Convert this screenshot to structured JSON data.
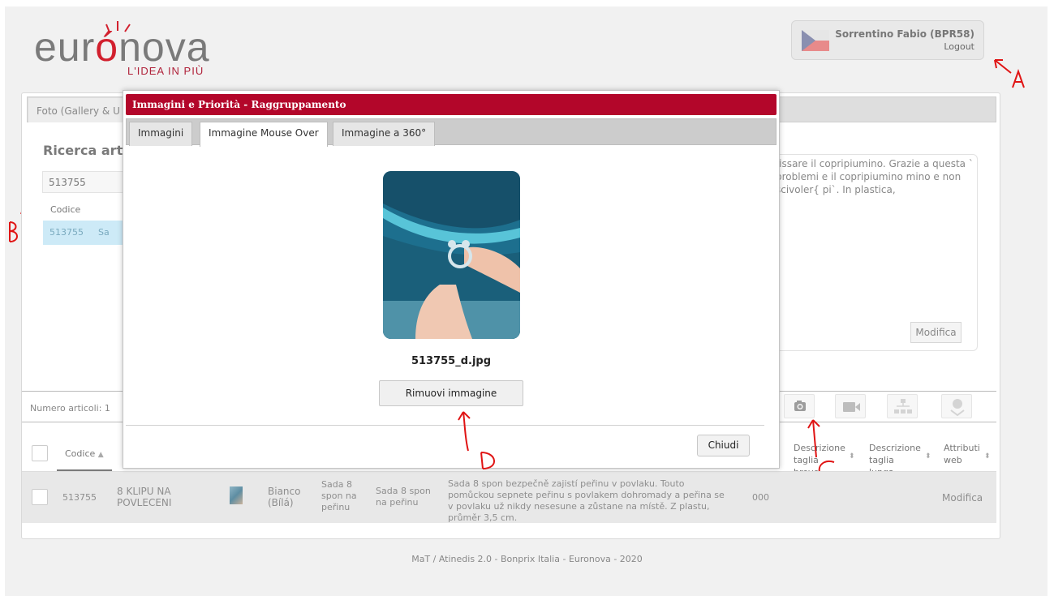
{
  "brand": {
    "logo_prefix": "eur",
    "logo_accent": "ó",
    "logo_suffix": "nova",
    "tagline": "L'IDEA IN PIÙ"
  },
  "user": {
    "name": "Sorrentino Fabio (BPR58)",
    "logout_label": "Logout",
    "flag_icon": "czech-flag-icon"
  },
  "annotations": {
    "a": "A",
    "b": "B",
    "c": "C",
    "d": "D"
  },
  "background": {
    "tab_label": "Foto (Gallery & U",
    "search_title": "Ricerca art",
    "search_value": "513755",
    "result_header": "Codice",
    "result_code": "513755",
    "result_fragment": "Sa",
    "description_text": "fissare il copripiumino. Grazie a questa ` problemi e il copripiumino mino e non scivoler{ pi`. In plastica,",
    "modifica_label": "Modifica",
    "numero_articoli": "Numero articoli: 1",
    "icons": [
      "camera-icon",
      "video-icon",
      "hierarchy-icon",
      "download-icon"
    ]
  },
  "table": {
    "headers": {
      "codice": "Codice",
      "descrizione_breve": "Descrizione taglia breve",
      "descrizione_lunga": "Descrizione taglia lunga",
      "attributi_web": "Attributi web"
    },
    "row": {
      "codice": "513755",
      "nome": "8 KLIPU NA POVLECENI",
      "colore": "Bianco (Bílá)",
      "breve": "Sada 8 spon na peřinu",
      "media": "Sada 8 spon na peřinu",
      "lunga": "Sada 8 spon bezpečně zajistí peřinu v povlaku. Touto pomůckou sepnete peřinu s povlakem dohromady a peřina se v povlaku už nikdy nesesune a zůstane na místě. Z plastu, průměr 3,5 cm.",
      "taglia": "000",
      "attributi": "Modifica"
    }
  },
  "modal": {
    "title": "Immagini e Priorità - Raggruppamento",
    "tabs": [
      "Immagini",
      "Immagine Mouse Over",
      "Immagine a 360°"
    ],
    "active_tab": "Immagine Mouse Over",
    "filename": "513755_d.jpg",
    "remove_label": "Rimuovi immagine",
    "close_label": "Chiudi"
  },
  "footer": "MaT / Atinedis 2.0 - Bonprix Italia - Euronova - 2020",
  "colors": {
    "modal_header": "#b3062a",
    "brand_red": "#d2202e",
    "selected_row": "#cdeaf7"
  }
}
